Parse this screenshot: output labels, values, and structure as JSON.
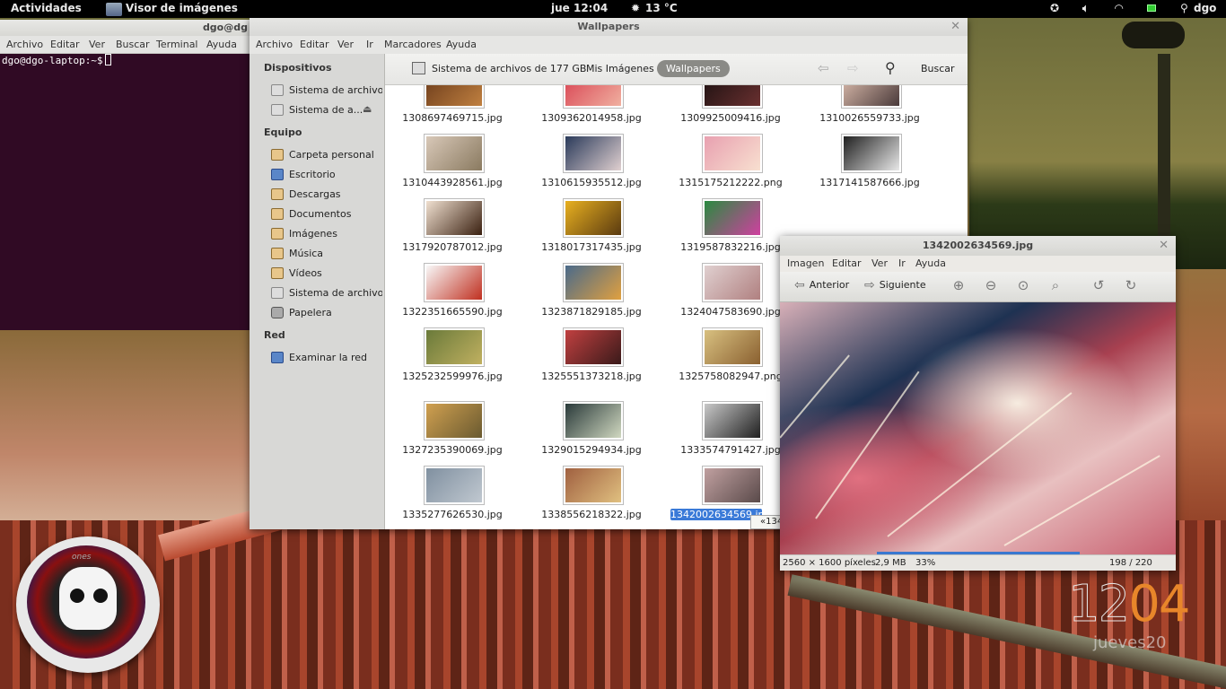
{
  "panel": {
    "activities": "Actividades",
    "app_name": "Visor de imágenes",
    "clock": "jue 12:04",
    "weather": "13 °C",
    "user": "dgo"
  },
  "terminal": {
    "title": "dgo@dg",
    "menu": [
      "Archivo",
      "Editar",
      "Ver",
      "Buscar",
      "Terminal",
      "Ayuda"
    ],
    "prompt": "dgo@dgo-laptop:~$"
  },
  "files": {
    "title": "Wallpapers",
    "menu": [
      "Archivo",
      "Editar",
      "Ver",
      "Ir",
      "Marcadores",
      "Ayuda"
    ],
    "sidebar": {
      "devices_header": "Dispositivos",
      "devices": [
        "Sistema de archivo...",
        "Sistema de a..."
      ],
      "computer_header": "Equipo",
      "computer": [
        "Carpeta personal",
        "Escritorio",
        "Descargas",
        "Documentos",
        "Imágenes",
        "Música",
        "Vídeos",
        "Sistema de archivos",
        "Papelera"
      ],
      "network_header": "Red",
      "network": [
        "Examinar la red"
      ]
    },
    "toolbar": {
      "fs_label": "Sistema de archivos de 177 GB",
      "crumb_parent": "Mis Imágenes",
      "crumb_current": "Wallpapers",
      "search_label": "Buscar"
    },
    "files": [
      "1308697469715.jpg",
      "1309362014958.jpg",
      "1309925009416.jpg",
      "1310026559733.jpg",
      "1310443928561.jpg",
      "1310615935512.jpg",
      "1315175212222.png",
      "1317141587666.jpg",
      "1317920787012.jpg",
      "1318017317435.jpg",
      "1319587832216.jpg",
      "",
      "1322351665590.jpg",
      "1323871829185.jpg",
      "1324047583690.jpg",
      "",
      "1325232599976.jpg",
      "1325551373218.jpg",
      "1325758082947.png",
      "",
      "1327235390069.jpg",
      "1329015294934.jpg",
      "1333574791427.jpg",
      "",
      "1335277626530.jpg",
      "1338556218322.jpg",
      "1342002634569.jpg",
      ""
    ],
    "tooltip": "«134"
  },
  "viewer": {
    "title": "1342002634569.jpg",
    "menu": [
      "Imagen",
      "Editar",
      "Ver",
      "Ir",
      "Ayuda"
    ],
    "prev_label": "Anterior",
    "next_label": "Siguiente",
    "dimensions": "2560 × 1600 píxeles",
    "size": "2,9 MB",
    "zoom": "33%",
    "position": "198 / 220"
  },
  "desktop": {
    "sticker_text": "ones",
    "clock_hours": "12",
    "clock_minutes": "04",
    "clock_day": "jueves20"
  }
}
